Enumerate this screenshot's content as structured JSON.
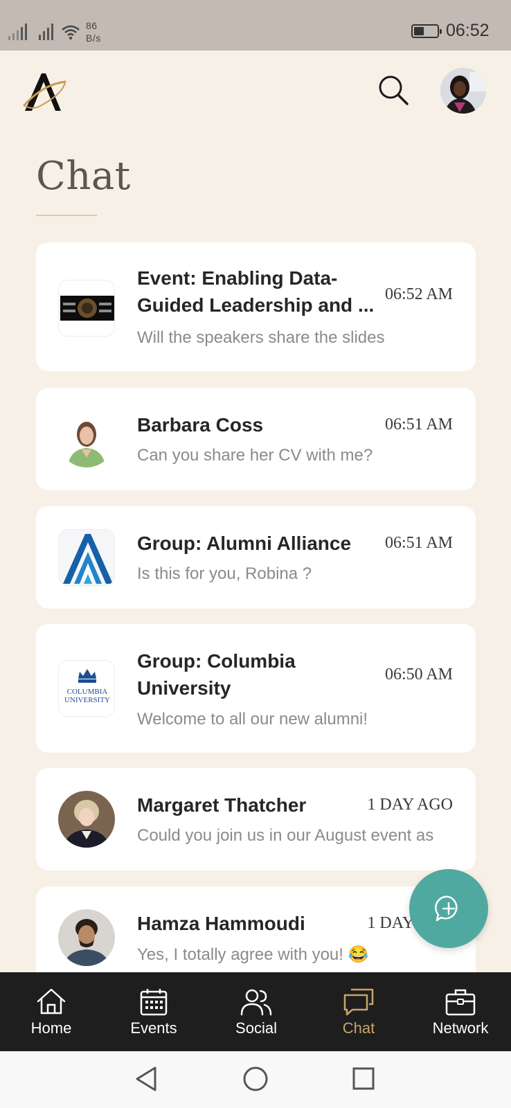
{
  "status_bar": {
    "speed_value": "86",
    "speed_unit": "B/s",
    "time": "06:52",
    "icons": [
      "signal-icon",
      "signal-r-icon",
      "wifi-icon",
      "battery-icon"
    ]
  },
  "header": {
    "logo": "alumni-logo",
    "search_icon": "search-icon",
    "avatar": "user-avatar"
  },
  "page": {
    "title": "Chat"
  },
  "chats": [
    {
      "name_line1": "Event: Enabling Data-",
      "name_line2": "Guided Leadership and ...",
      "time": "06:52 AM",
      "preview": "Will the speakers share the slides",
      "thumb": "event-banner"
    },
    {
      "name": "Barbara Coss",
      "time": "06:51 AM",
      "preview": "Can you share her CV with me?",
      "thumb": "person-avatar"
    },
    {
      "name": "Group: Alumni Alliance",
      "time": "06:51 AM",
      "preview": "Is this for you, Robina ?",
      "thumb": "alumni-alliance-logo"
    },
    {
      "name_line1": "Group: Columbia",
      "name_line2": "University",
      "time": "06:50 AM",
      "preview": "Welcome to all our new alumni!",
      "thumb": "columbia-logo",
      "thumb_text1": "COLUMBIA",
      "thumb_text2": "UNIVERSITY"
    },
    {
      "name": "Margaret Thatcher",
      "time": "1 DAY AGO",
      "preview": "Could you join us in our August event as",
      "thumb": "person-avatar"
    },
    {
      "name": "Hamza Hammoudi",
      "time": "1 DAY AGO",
      "preview": "Yes, I totally agree with you! 😂",
      "thumb": "person-avatar"
    }
  ],
  "fab": {
    "icon": "new-chat-icon"
  },
  "bottom_nav": [
    {
      "label": "Home",
      "icon": "home-icon",
      "active": false
    },
    {
      "label": "Events",
      "icon": "calendar-icon",
      "active": false
    },
    {
      "label": "Social",
      "icon": "people-icon",
      "active": false
    },
    {
      "label": "Chat",
      "icon": "chat-icon",
      "active": true
    },
    {
      "label": "Network",
      "icon": "briefcase-icon",
      "active": false
    }
  ],
  "colors": {
    "background": "#f7f0e6",
    "accent_teal": "#4fa9a0",
    "accent_gold": "#c9a46a",
    "nav_bg": "#1e1e1e"
  }
}
